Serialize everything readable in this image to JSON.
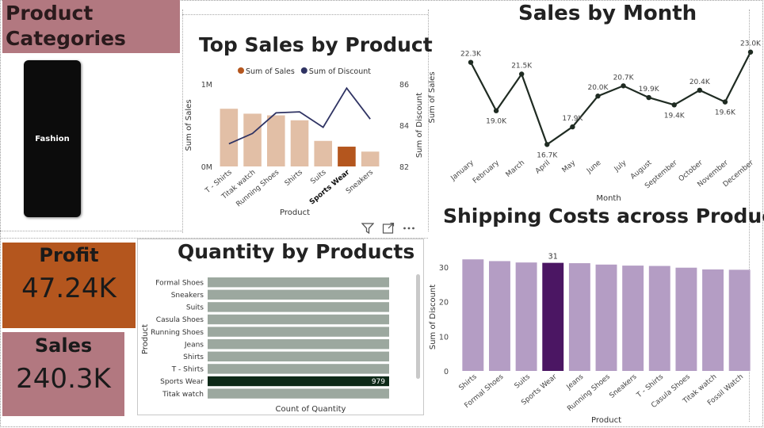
{
  "categories_panel": {
    "title": "Product Categories",
    "slicer_item": "Fashion"
  },
  "kpis": {
    "profit": {
      "label": "Profit",
      "value": "47.24K"
    },
    "sales": {
      "label": "Sales",
      "value": "240.3K"
    }
  },
  "colors": {
    "sales_bar": "#e2bfa6",
    "sales_bar_highlight": "#b4561e",
    "discount_line": "#2f3363",
    "month_line": "#1f2b22",
    "qty_bar": "#9ca89f",
    "qty_bar_highlight": "#0e2a18",
    "ship_bar": "#b49dc4",
    "ship_bar_highlight": "#4b1663",
    "profit_card": "#b4561e",
    "sales_card": "#b27880"
  },
  "visual_header_icons": [
    "filter-icon",
    "focus-mode-icon",
    "more-options-icon"
  ],
  "chart_data": [
    {
      "id": "top_sales",
      "type": "bar",
      "title": "Top Sales by Product",
      "categories": [
        "T - Shirts",
        "Titak watch",
        "Running Shoes",
        "Shirts",
        "Suits",
        "Sports Wear",
        "Sneakers"
      ],
      "highlight": "Sports Wear",
      "series": [
        {
          "name": "Sum of Sales",
          "type": "bar",
          "axis": "left",
          "values": [
            700000,
            640000,
            620000,
            560000,
            310000,
            240000,
            180000
          ]
        },
        {
          "name": "Sum of Discount",
          "type": "line",
          "axis": "right",
          "values": [
            83.1,
            83.6,
            84.6,
            84.65,
            83.9,
            85.8,
            84.3
          ]
        }
      ],
      "xlabel": "Product",
      "ylabel": "Sum of Sales",
      "y2label": "Sum of Discount",
      "yticks": [
        "0M",
        "1M"
      ],
      "y2ticks": [
        "82",
        "84",
        "86"
      ],
      "ylim": [
        0,
        1000000
      ],
      "y2lim": [
        82,
        86
      ],
      "legend": "top"
    },
    {
      "id": "sales_by_month",
      "type": "line",
      "title": "Sales by Month",
      "categories": [
        "January",
        "February",
        "March",
        "April",
        "May",
        "June",
        "July",
        "August",
        "September",
        "October",
        "November",
        "December"
      ],
      "values": [
        22.3,
        19.0,
        21.5,
        16.7,
        17.9,
        20.0,
        20.7,
        19.9,
        19.4,
        20.4,
        19.6,
        23.0
      ],
      "labels": [
        "22.3K",
        "19.0K",
        "21.5K",
        "16.7K",
        "17.9K",
        "20.0K",
        "20.7K",
        "19.9K",
        "19.4K",
        "20.4K",
        "19.6K",
        "23.0K"
      ],
      "xlabel": "Month",
      "ylabel": "Sum of Sales",
      "ylim": [
        16.5,
        23.2
      ]
    },
    {
      "id": "quantity_by_products",
      "type": "bar",
      "orientation": "horizontal",
      "title": "Quantity by Products",
      "categories": [
        "Formal Shoes",
        "Sneakers",
        "Suits",
        "Casula Shoes",
        "Running Shoes",
        "Jeans",
        "Shirts",
        "T - Shirts",
        "Sports Wear",
        "Titak watch"
      ],
      "values": [
        979,
        979,
        979,
        979,
        979,
        979,
        979,
        979,
        979,
        979
      ],
      "highlight": "Sports Wear",
      "data_label": "979",
      "xlabel": "Count of Quantity",
      "ylabel": "Product",
      "xlim": [
        0,
        979
      ]
    },
    {
      "id": "shipping_costs",
      "type": "bar",
      "title": "Shipping Costs across Product",
      "categories": [
        "Shirts",
        "Formal Shoes",
        "Suits",
        "Sports Wear",
        "Jeans",
        "Running Shoes",
        "Sneakers",
        "T - Shirts",
        "Casula Shoes",
        "Titak watch",
        "Fossil Watch"
      ],
      "values": [
        32.2,
        31.7,
        31.3,
        31.2,
        31.1,
        30.7,
        30.4,
        30.3,
        29.8,
        29.3,
        29.2
      ],
      "highlight": "Sports Wear",
      "data_label": "31",
      "xlabel": "Product",
      "ylabel": "Sum of Discount",
      "yticks": [
        "0",
        "10",
        "20",
        "30"
      ],
      "ylim": [
        0,
        35
      ]
    }
  ]
}
